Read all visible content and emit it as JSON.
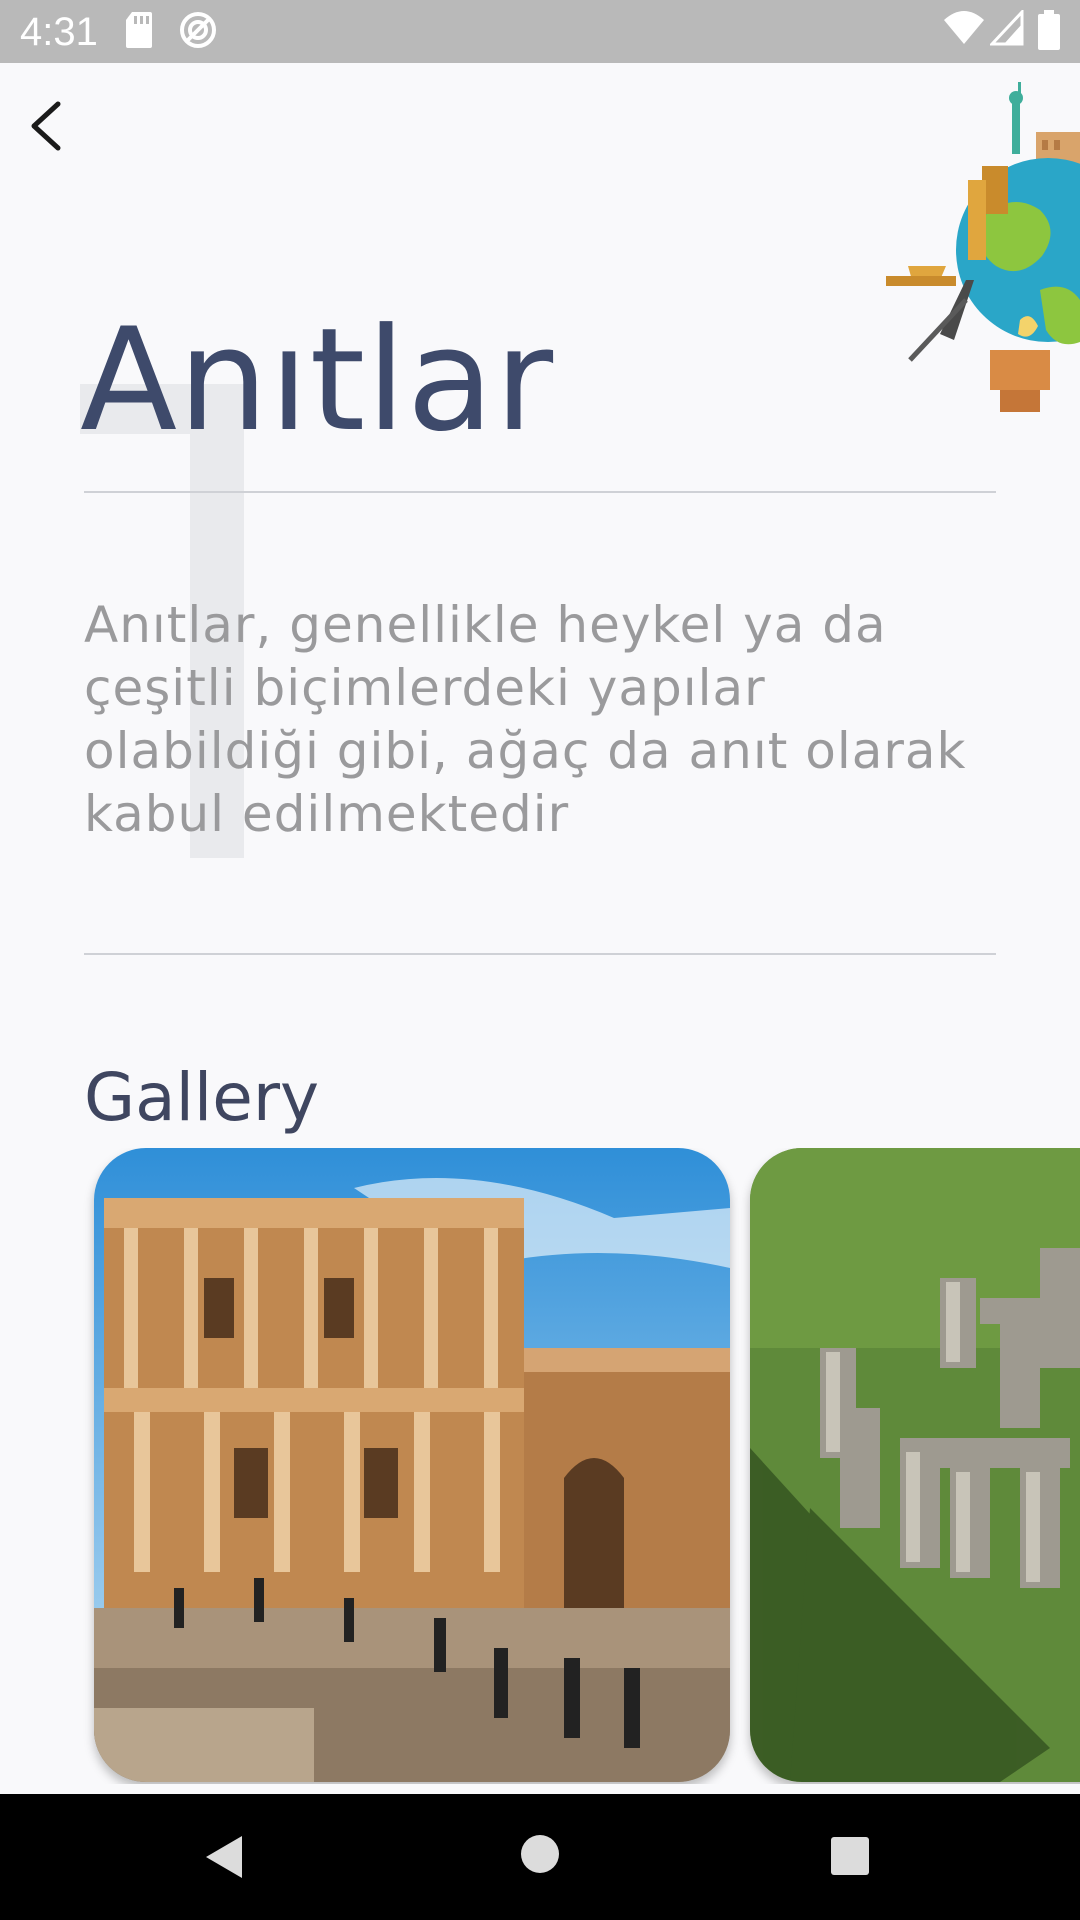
{
  "status_bar": {
    "time": "4:31",
    "icons": [
      "sd-card-icon",
      "sync-off-icon",
      "wifi-icon",
      "signal-icon",
      "battery-icon"
    ]
  },
  "header": {
    "back_icon": "chevron-left-icon",
    "illustration": "globe-landmarks-illustration"
  },
  "page": {
    "title": "Anıtlar",
    "description": "Anıtlar, genellikle heykel ya da çeşitli biçimlerdeki yapılar olabildiği gibi, ağaç da anıt olarak kabul edilmektedir"
  },
  "gallery": {
    "heading": "Gallery",
    "items": [
      {
        "image": "ancient-library-ruins-photo"
      },
      {
        "image": "stonehenge-photo"
      }
    ]
  },
  "nav_bar": {
    "back": "triangle-back-icon",
    "home": "circle-home-icon",
    "recents": "square-recents-icon"
  },
  "colors": {
    "title": "#3e4a6b",
    "description": "#9a9a9c",
    "background": "#f9f9fb",
    "status_bar": "#b9b9b9"
  }
}
